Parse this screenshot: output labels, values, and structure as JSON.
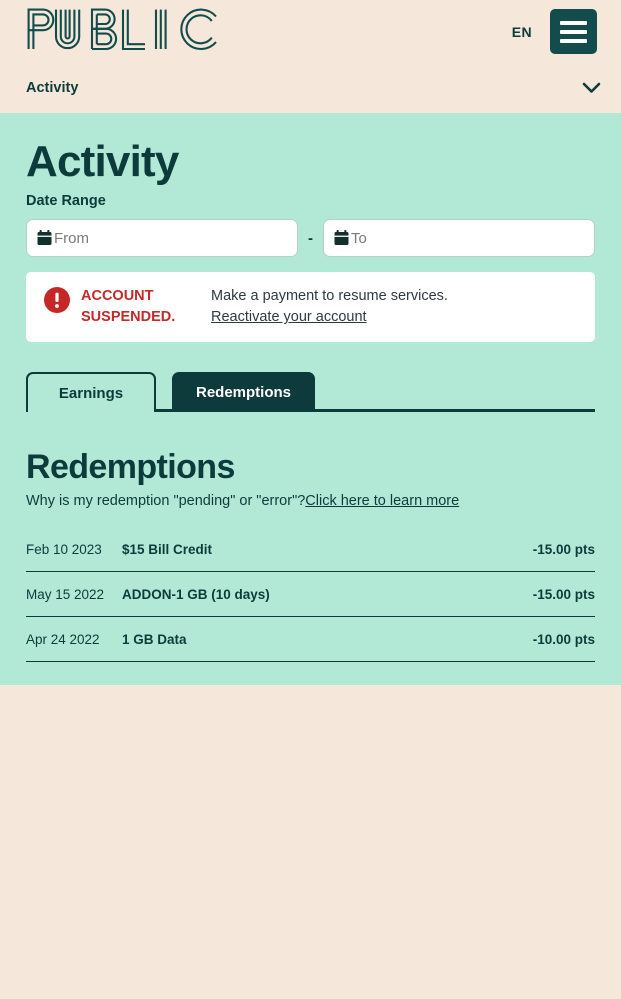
{
  "header": {
    "logo_text": "PUBLIC",
    "logo_icon": "public-wordmark-logo",
    "language_label": "EN",
    "menu_icon": "hamburger-menu-icon"
  },
  "subnav": {
    "label": "Activity",
    "chevron_icon": "chevron-down-icon"
  },
  "panel": {
    "page_title": "Activity",
    "date_range": {
      "label": "Date Range",
      "from_placeholder": "From",
      "from_value": "",
      "to_placeholder": "To",
      "to_value": "",
      "separator": "-",
      "calendar_icon": "calendar-icon"
    },
    "alert": {
      "icon": "exclamation-circle-icon",
      "title": "ACCOUNT SUSPENDED.",
      "body_text": "Make a payment to resume services. ",
      "link_text": "Reactivate your account",
      "accent_color": "#c62828"
    },
    "tabs": [
      {
        "label": "Earnings",
        "active": false
      },
      {
        "label": "Redemptions",
        "active": true
      }
    ],
    "redemptions": {
      "title": "Redemptions",
      "help_text": "Why is my redemption \"pending\" or \"error\"?",
      "help_link": "Click here to learn more",
      "rows": [
        {
          "date": "Feb 10 2023",
          "description": "$15 Bill Credit",
          "amount": "-15.00 pts"
        },
        {
          "date": "May 15 2022",
          "description": "ADDON-1 GB (10 days)",
          "amount": "-15.00 pts"
        },
        {
          "date": "Apr 24 2022",
          "description": "1 GB Data",
          "amount": "-10.00 pts"
        }
      ]
    }
  },
  "colors": {
    "page_background": "#f5e8da",
    "panel_background": "#b1e9d6",
    "primary_dark": "#0d3b3b",
    "alert_red": "#c62828",
    "white": "#ffffff"
  }
}
